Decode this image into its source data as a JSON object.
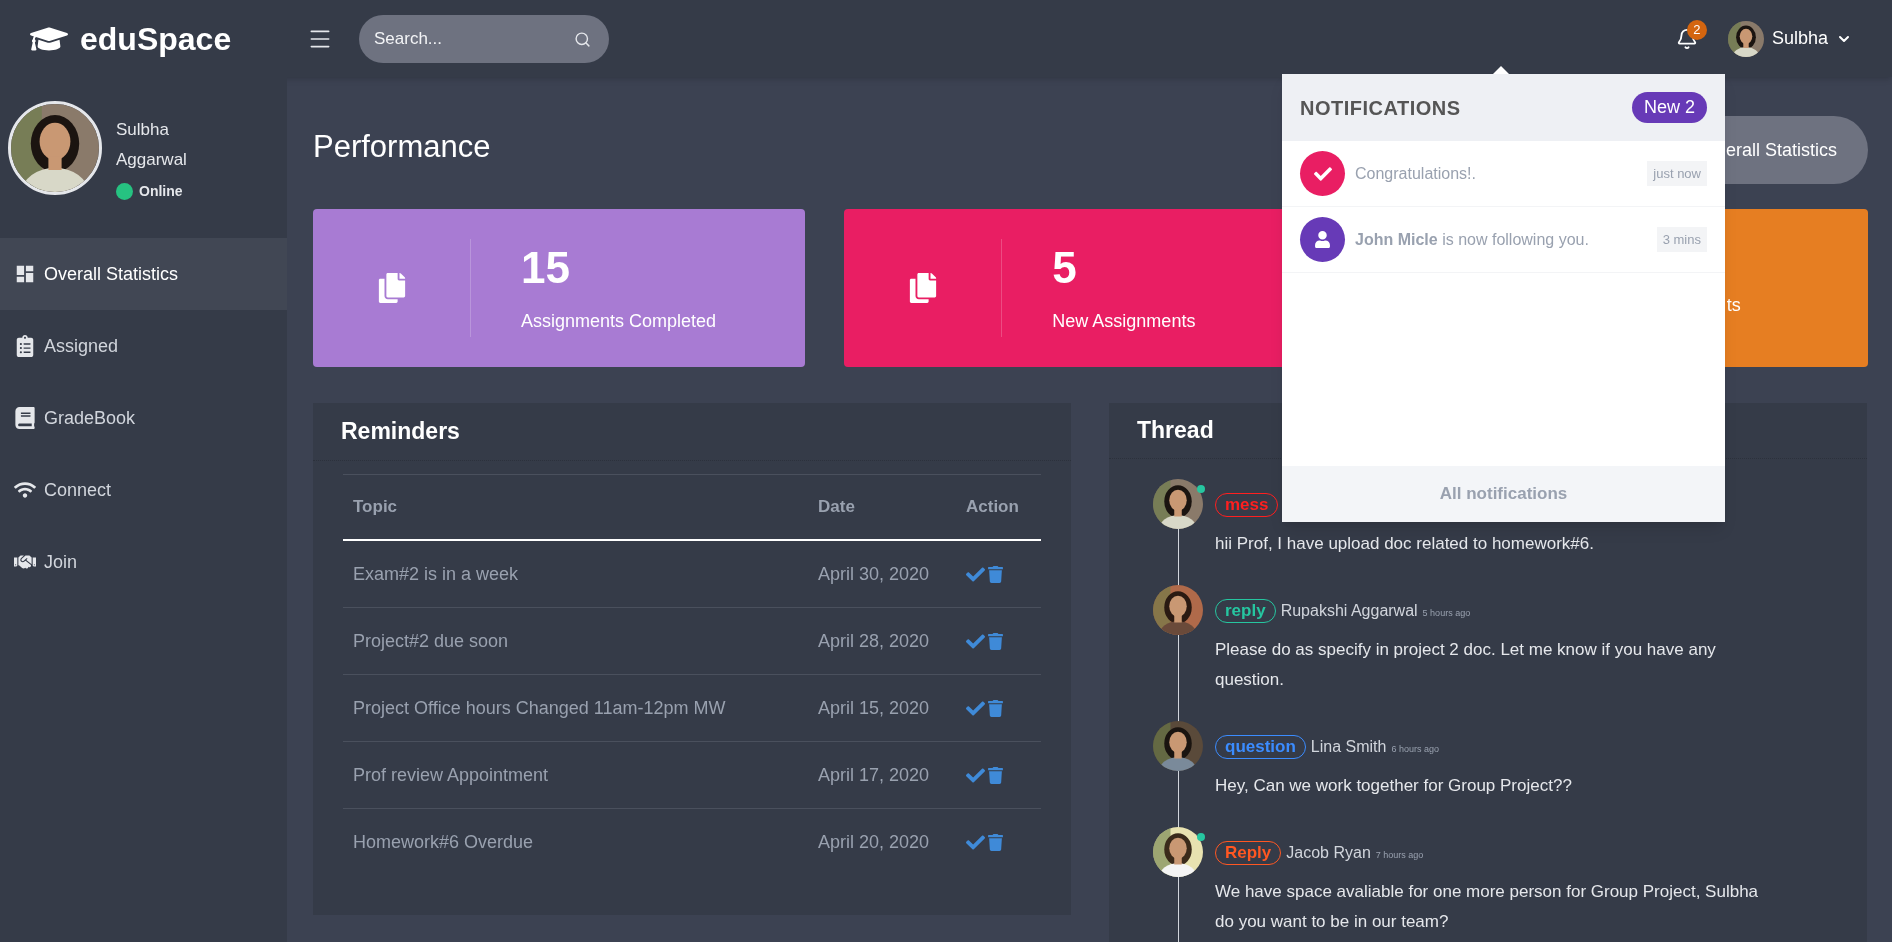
{
  "header": {
    "logo": "eduSpace",
    "search": {
      "placeholder": "Search..."
    },
    "notification_count": "2",
    "user": {
      "name": "Sulbha"
    }
  },
  "sidebar": {
    "profile": {
      "name": "Sulbha Aggarwal",
      "status": "Online",
      "online": true
    },
    "items": [
      {
        "label": "Overall Statistics",
        "selected": true
      },
      {
        "label": "Assigned",
        "selected": false
      },
      {
        "label": "GradeBook",
        "selected": false
      },
      {
        "label": "Connect",
        "selected": false
      },
      {
        "label": "Join",
        "selected": false
      }
    ]
  },
  "page": {
    "title": "Performance",
    "action_button": "erall Statistics"
  },
  "stat_cards": [
    {
      "value": "15",
      "label": "Assignments Completed",
      "color": "#a87bd3"
    },
    {
      "value": "5",
      "label": "New Assignments",
      "color": "#e91e63"
    },
    {
      "label": "ts",
      "color": "#e67e22"
    }
  ],
  "reminders": {
    "title": "Reminders",
    "columns": [
      "Topic",
      "Date",
      "Action"
    ],
    "rows": [
      {
        "topic": "Exam#2 is in a week",
        "date": "April 30, 2020"
      },
      {
        "topic": "Project#2 due soon",
        "date": "April 28, 2020"
      },
      {
        "topic": "Project Office hours Changed 11am-12pm MW",
        "date": "April 15, 2020"
      },
      {
        "topic": "Prof review Appointment",
        "date": "April 17, 2020"
      },
      {
        "topic": "Homework#6 Overdue",
        "date": "April 20, 2020"
      }
    ]
  },
  "thread": {
    "title": "Thread",
    "items": [
      {
        "tag": "mess",
        "color": "#ff1f1f",
        "online": true,
        "message": "hii Prof, I have upload doc related to homework#6."
      },
      {
        "tag": "reply",
        "color": "#26c6a0",
        "author": "Rupakshi Aggarwal",
        "time": "5 hours ago",
        "online": false,
        "message": "Please do as specify in project 2 doc. Let me know if you have any question."
      },
      {
        "tag": "question",
        "color": "#3b8cff",
        "author": "Lina Smith",
        "time": "6 hours ago",
        "online": false,
        "message": "Hey, Can we work together for Group Project??"
      },
      {
        "tag": "Reply",
        "color": "#ff5722",
        "author": "Jacob Ryan",
        "time": "7 hours ago",
        "online": true,
        "message": "We have space avaliable for one more person for Group Project, Sulbha do you want to be in our team?"
      }
    ]
  },
  "notifications": {
    "title": "NOTIFICATIONS",
    "badge": "New 2",
    "items": [
      {
        "kind": "success",
        "text": "Congratulations!.",
        "time": "just now"
      },
      {
        "kind": "follow",
        "text": "**John Micle** is now following you.",
        "time": "3 mins"
      }
    ],
    "footer": "All notifications"
  }
}
